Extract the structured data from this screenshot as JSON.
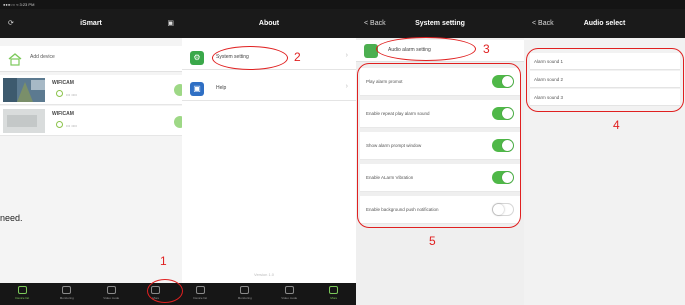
{
  "panel_device_list": {
    "status_text": "●●●○○ ≈   3:23 PM",
    "nav_title": "iSmart",
    "add_label": "Add device",
    "cameras": [
      {
        "name": "WIFICAM",
        "sub": "••• ••••"
      },
      {
        "name": "WIFICAM",
        "sub": "••• ••••"
      }
    ],
    "side_text": "need.",
    "tabs": [
      {
        "label": "Device list",
        "icon": "camera-tab-icon"
      },
      {
        "label": "Monitoring",
        "icon": "monitor-tab-icon"
      },
      {
        "label": "Video mode",
        "icon": "video-tab-icon"
      },
      {
        "label": "More",
        "icon": "more-tab-icon"
      },
      {
        "label": "Device list",
        "icon": "camera-tab-icon"
      },
      {
        "label": "Monitoring",
        "icon": "monitor-tab-icon"
      },
      {
        "label": "Video mode",
        "icon": "video-tab-icon"
      },
      {
        "label": "More",
        "icon": "more-tab-icon"
      }
    ]
  },
  "panel_about": {
    "nav_title": "About",
    "rows": [
      {
        "label": "System setting",
        "icon": "gear-icon",
        "color": "#3aa84a"
      },
      {
        "label": "Help",
        "icon": "book-icon",
        "color": "#2f6fc4"
      }
    ],
    "version": "Version 1.0"
  },
  "panel_system_setting": {
    "back_label": "< Back",
    "nav_title": "System setting",
    "alarm_header": "Audio alarm setting",
    "settings": [
      {
        "label": "Play alarm promot",
        "on": true
      },
      {
        "label": "Enable repeat play alarm sound",
        "on": true
      },
      {
        "label": "Show alarm prompt window",
        "on": true
      },
      {
        "label": "Enable ALarm Vibration",
        "on": true
      },
      {
        "label": "Enable background push notification",
        "on": false
      }
    ]
  },
  "panel_audio_select": {
    "back_label": "< Back",
    "nav_title": "Audio select",
    "sounds": [
      "Alarm sound 1",
      "Alarm sound 2",
      "Alarm sound 3"
    ]
  },
  "annotations": {
    "n1": "1",
    "n2": "2",
    "n3": "3",
    "n4": "4",
    "n5": "5",
    "color": "#e02020"
  }
}
